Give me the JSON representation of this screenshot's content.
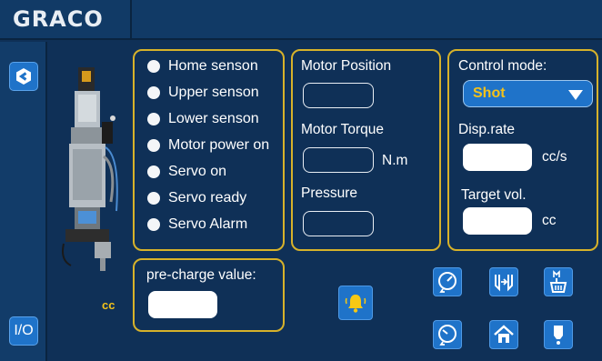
{
  "brand": {
    "name": "GRACO",
    "logo_icon": "graco-logo-icon"
  },
  "nav": {
    "io_label": "I/O"
  },
  "status": {
    "items": [
      {
        "label": "Home senson",
        "state": "off"
      },
      {
        "label": "Upper senson",
        "state": "off"
      },
      {
        "label": "Lower senson",
        "state": "off"
      },
      {
        "label": "Motor power on",
        "state": "off"
      },
      {
        "label": "Servo on",
        "state": "off"
      },
      {
        "label": "Servo ready",
        "state": "off"
      },
      {
        "label": "Servo Alarm",
        "state": "off"
      }
    ]
  },
  "motor": {
    "position_label": "Motor Position",
    "position_value": "",
    "torque_label": "Motor Torque",
    "torque_value": "",
    "torque_unit": "N.m",
    "pressure_label": "Pressure",
    "pressure_value": ""
  },
  "control": {
    "mode_label": "Control mode:",
    "mode_value": "Shot",
    "disp_rate_label": "Disp.rate",
    "disp_rate_value": "",
    "disp_rate_unit": "cc/s",
    "target_vol_label": "Target vol.",
    "target_vol_value": "",
    "target_vol_unit": "cc"
  },
  "precharge": {
    "label": "pre-charge value:",
    "value": ""
  },
  "device": {
    "volume_unit": "cc"
  },
  "colors": {
    "background": "#0f3057",
    "accent_border": "#d7b22a",
    "button_blue": "#1f73c9",
    "select_text": "#f3c21a",
    "alarm_bell": "#f6c814"
  }
}
